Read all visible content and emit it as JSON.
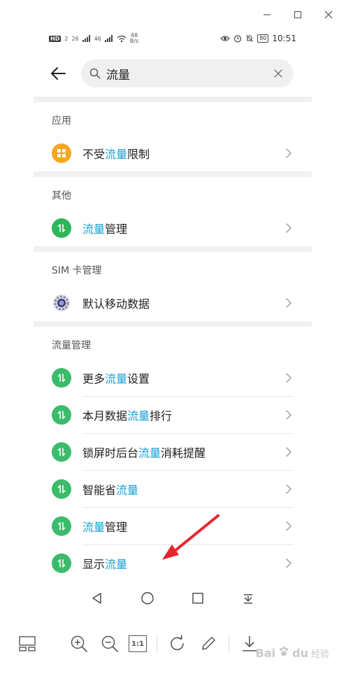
{
  "status_bar": {
    "hd_badge": "HD",
    "sim1": "2",
    "net1": "26",
    "net2": "46",
    "speed_value": "48",
    "speed_unit": "B/s",
    "battery": "80",
    "time": "10:51"
  },
  "search": {
    "query": "流量",
    "placeholder": ""
  },
  "sections": [
    {
      "title": "应用",
      "items": [
        {
          "pre": "不受",
          "hl": "流量",
          "post": "限制",
          "icon": "grid-app-icon",
          "color": "#f5a623"
        }
      ]
    },
    {
      "title": "其他",
      "items": [
        {
          "pre": "",
          "hl": "流量",
          "post": "管理",
          "icon": "data-transfer-icon",
          "color": "#2fb55a"
        }
      ]
    },
    {
      "title": "SIM 卡管理",
      "items": [
        {
          "pre": "默认移动数据",
          "hl": "",
          "post": "",
          "icon": "settings-gear-icon",
          "color": "#7b7bd0"
        }
      ]
    },
    {
      "title": "流量管理",
      "items": [
        {
          "pre": "更多",
          "hl": "流量",
          "post": "设置",
          "icon": "data-transfer-icon",
          "color": "#3cbb6a"
        },
        {
          "pre": "本月数据",
          "hl": "流量",
          "post": "排行",
          "icon": "data-transfer-icon",
          "color": "#3cbb6a"
        },
        {
          "pre": "锁屏时后台",
          "hl": "流量",
          "post": "消耗提醒",
          "icon": "data-transfer-icon",
          "color": "#3cbb6a"
        },
        {
          "pre": "智能省",
          "hl": "流量",
          "post": "",
          "icon": "data-transfer-icon",
          "color": "#3cbb6a"
        },
        {
          "pre": "",
          "hl": "流量",
          "post": "管理",
          "icon": "data-transfer-icon",
          "color": "#3cbb6a"
        },
        {
          "pre": "显示",
          "hl": "流量",
          "post": "",
          "icon": "data-transfer-icon",
          "color": "#3cbb6a"
        }
      ]
    }
  ],
  "toolbar": {
    "actual_size_label": "1:1"
  },
  "watermark": {
    "brand": "Bai",
    "brand2": "du",
    "sub": "经验"
  },
  "colors": {
    "highlight": "#1a9fd6",
    "annotation_arrow": "#e8262d"
  }
}
